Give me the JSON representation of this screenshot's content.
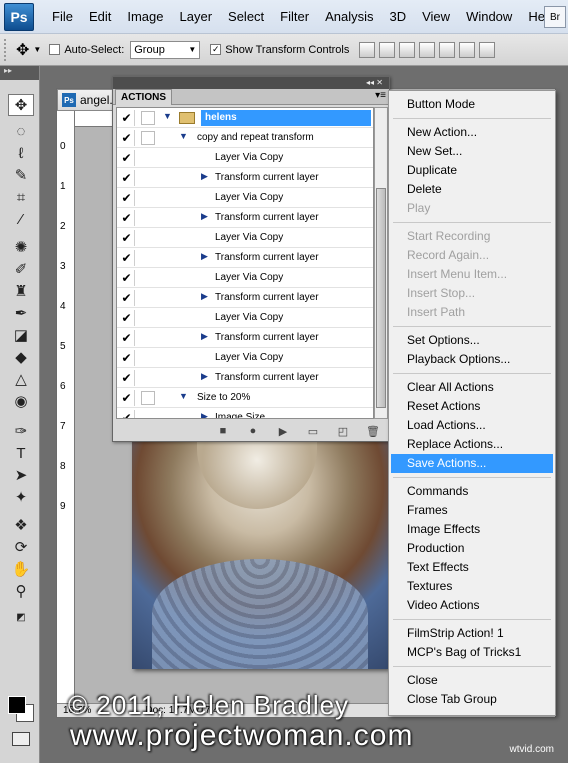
{
  "app": {
    "logo": "Ps",
    "window_btn": "Br"
  },
  "menubar": [
    "File",
    "Edit",
    "Image",
    "Layer",
    "Select",
    "Filter",
    "Analysis",
    "3D",
    "View",
    "Window",
    "Help"
  ],
  "optbar": {
    "auto_select_label": "Auto-Select:",
    "auto_select_checked": false,
    "group_value": "Group",
    "show_transform_label": "Show Transform Controls",
    "show_transform_checked": true
  },
  "document": {
    "tab_label": "angel.",
    "ruler_numbers": [
      "0",
      "1",
      "2",
      "3",
      "4",
      "5",
      "6",
      "7",
      "8",
      "9"
    ],
    "zoom": "16.7%",
    "doc_info": "Doc: 17.7M/17.4..."
  },
  "actions_panel": {
    "tab": "ACTIONS",
    "rows": [
      {
        "label": "helens",
        "checked": true,
        "selected": true,
        "type": "set"
      },
      {
        "label": "copy and repeat transform",
        "checked": true,
        "type": "action"
      },
      {
        "label": "Layer Via Copy",
        "checked": true,
        "type": "step",
        "expandable": false
      },
      {
        "label": "Transform current layer",
        "checked": true,
        "type": "step",
        "expandable": true
      },
      {
        "label": "Layer Via Copy",
        "checked": true,
        "type": "step",
        "expandable": false
      },
      {
        "label": "Transform current layer",
        "checked": true,
        "type": "step",
        "expandable": true
      },
      {
        "label": "Layer Via Copy",
        "checked": true,
        "type": "step",
        "expandable": false
      },
      {
        "label": "Transform current layer",
        "checked": true,
        "type": "step",
        "expandable": true
      },
      {
        "label": "Layer Via Copy",
        "checked": true,
        "type": "step",
        "expandable": false
      },
      {
        "label": "Transform current layer",
        "checked": true,
        "type": "step",
        "expandable": true
      },
      {
        "label": "Layer Via Copy",
        "checked": true,
        "type": "step",
        "expandable": false
      },
      {
        "label": "Transform current layer",
        "checked": true,
        "type": "step",
        "expandable": true
      },
      {
        "label": "Layer Via Copy",
        "checked": true,
        "type": "step",
        "expandable": false
      },
      {
        "label": "Transform current layer",
        "checked": true,
        "type": "step",
        "expandable": true
      },
      {
        "label": "Size to 20%",
        "checked": true,
        "type": "action"
      },
      {
        "label": "Image Size",
        "checked": true,
        "type": "step",
        "expandable": true
      }
    ],
    "footer_icons": [
      "stop-icon",
      "record-icon",
      "play-icon",
      "new-set-icon",
      "new-action-icon",
      "delete-icon"
    ]
  },
  "flyout": {
    "groups": [
      [
        {
          "label": "Button Mode",
          "enabled": true
        }
      ],
      [
        {
          "label": "New Action...",
          "enabled": true
        },
        {
          "label": "New Set...",
          "enabled": true
        },
        {
          "label": "Duplicate",
          "enabled": true
        },
        {
          "label": "Delete",
          "enabled": true
        },
        {
          "label": "Play",
          "enabled": false
        }
      ],
      [
        {
          "label": "Start Recording",
          "enabled": false
        },
        {
          "label": "Record Again...",
          "enabled": false
        },
        {
          "label": "Insert Menu Item...",
          "enabled": false
        },
        {
          "label": "Insert Stop...",
          "enabled": false
        },
        {
          "label": "Insert Path",
          "enabled": false
        }
      ],
      [
        {
          "label": "Set Options...",
          "enabled": true
        },
        {
          "label": "Playback Options...",
          "enabled": true
        }
      ],
      [
        {
          "label": "Clear All Actions",
          "enabled": true
        },
        {
          "label": "Reset Actions",
          "enabled": true
        },
        {
          "label": "Load Actions...",
          "enabled": true
        },
        {
          "label": "Replace Actions...",
          "enabled": true
        },
        {
          "label": "Save Actions...",
          "enabled": true,
          "highlighted": true
        }
      ],
      [
        {
          "label": "Commands",
          "enabled": true
        },
        {
          "label": "Frames",
          "enabled": true
        },
        {
          "label": "Image Effects",
          "enabled": true
        },
        {
          "label": "Production",
          "enabled": true
        },
        {
          "label": "Text Effects",
          "enabled": true
        },
        {
          "label": "Textures",
          "enabled": true
        },
        {
          "label": "Video Actions",
          "enabled": true
        }
      ],
      [
        {
          "label": "FilmStrip Action! 1",
          "enabled": true
        },
        {
          "label": "MCP's Bag of Tricks1",
          "enabled": true
        }
      ],
      [
        {
          "label": "Close",
          "enabled": true
        },
        {
          "label": "Close Tab Group",
          "enabled": true
        }
      ]
    ]
  },
  "watermark": {
    "line1": "© 2011, Helen Bradley",
    "line2": "www.projectwoman.com",
    "site_tag": "wtvid.com"
  }
}
